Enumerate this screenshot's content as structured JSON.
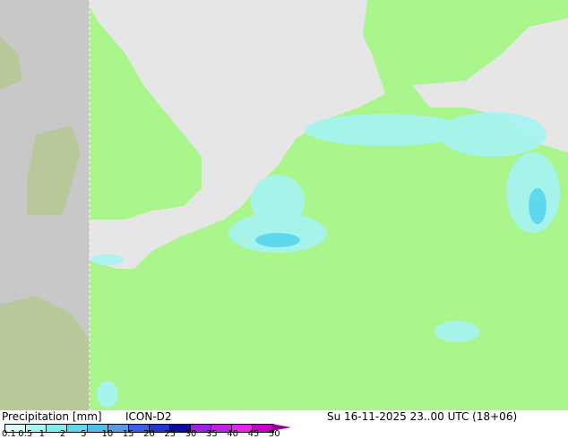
{
  "title": "Precipitation [mm]",
  "model": "ICON-D2",
  "datetime": "Su 16-11-2025 23..00 UTC (18+06)",
  "legend": {
    "ticks": [
      "0.1",
      "0.5",
      "1",
      "2",
      "5",
      "10",
      "15",
      "20",
      "25",
      "30",
      "35",
      "40",
      "45",
      "50"
    ],
    "colors": [
      "#dcfafa",
      "#a6f4f4",
      "#80eeee",
      "#5ed8ee",
      "#4ac0ea",
      "#5a9ae8",
      "#3c5cea",
      "#2036cc",
      "#0c0ca4",
      "#a020e8",
      "#c81ee6",
      "#f020f0",
      "#c800c8"
    ],
    "arrow_color": "#960096"
  },
  "colors": {
    "land": "#aaf58c",
    "sea": "#e6e6e6",
    "outside": "#c8c8c8"
  }
}
